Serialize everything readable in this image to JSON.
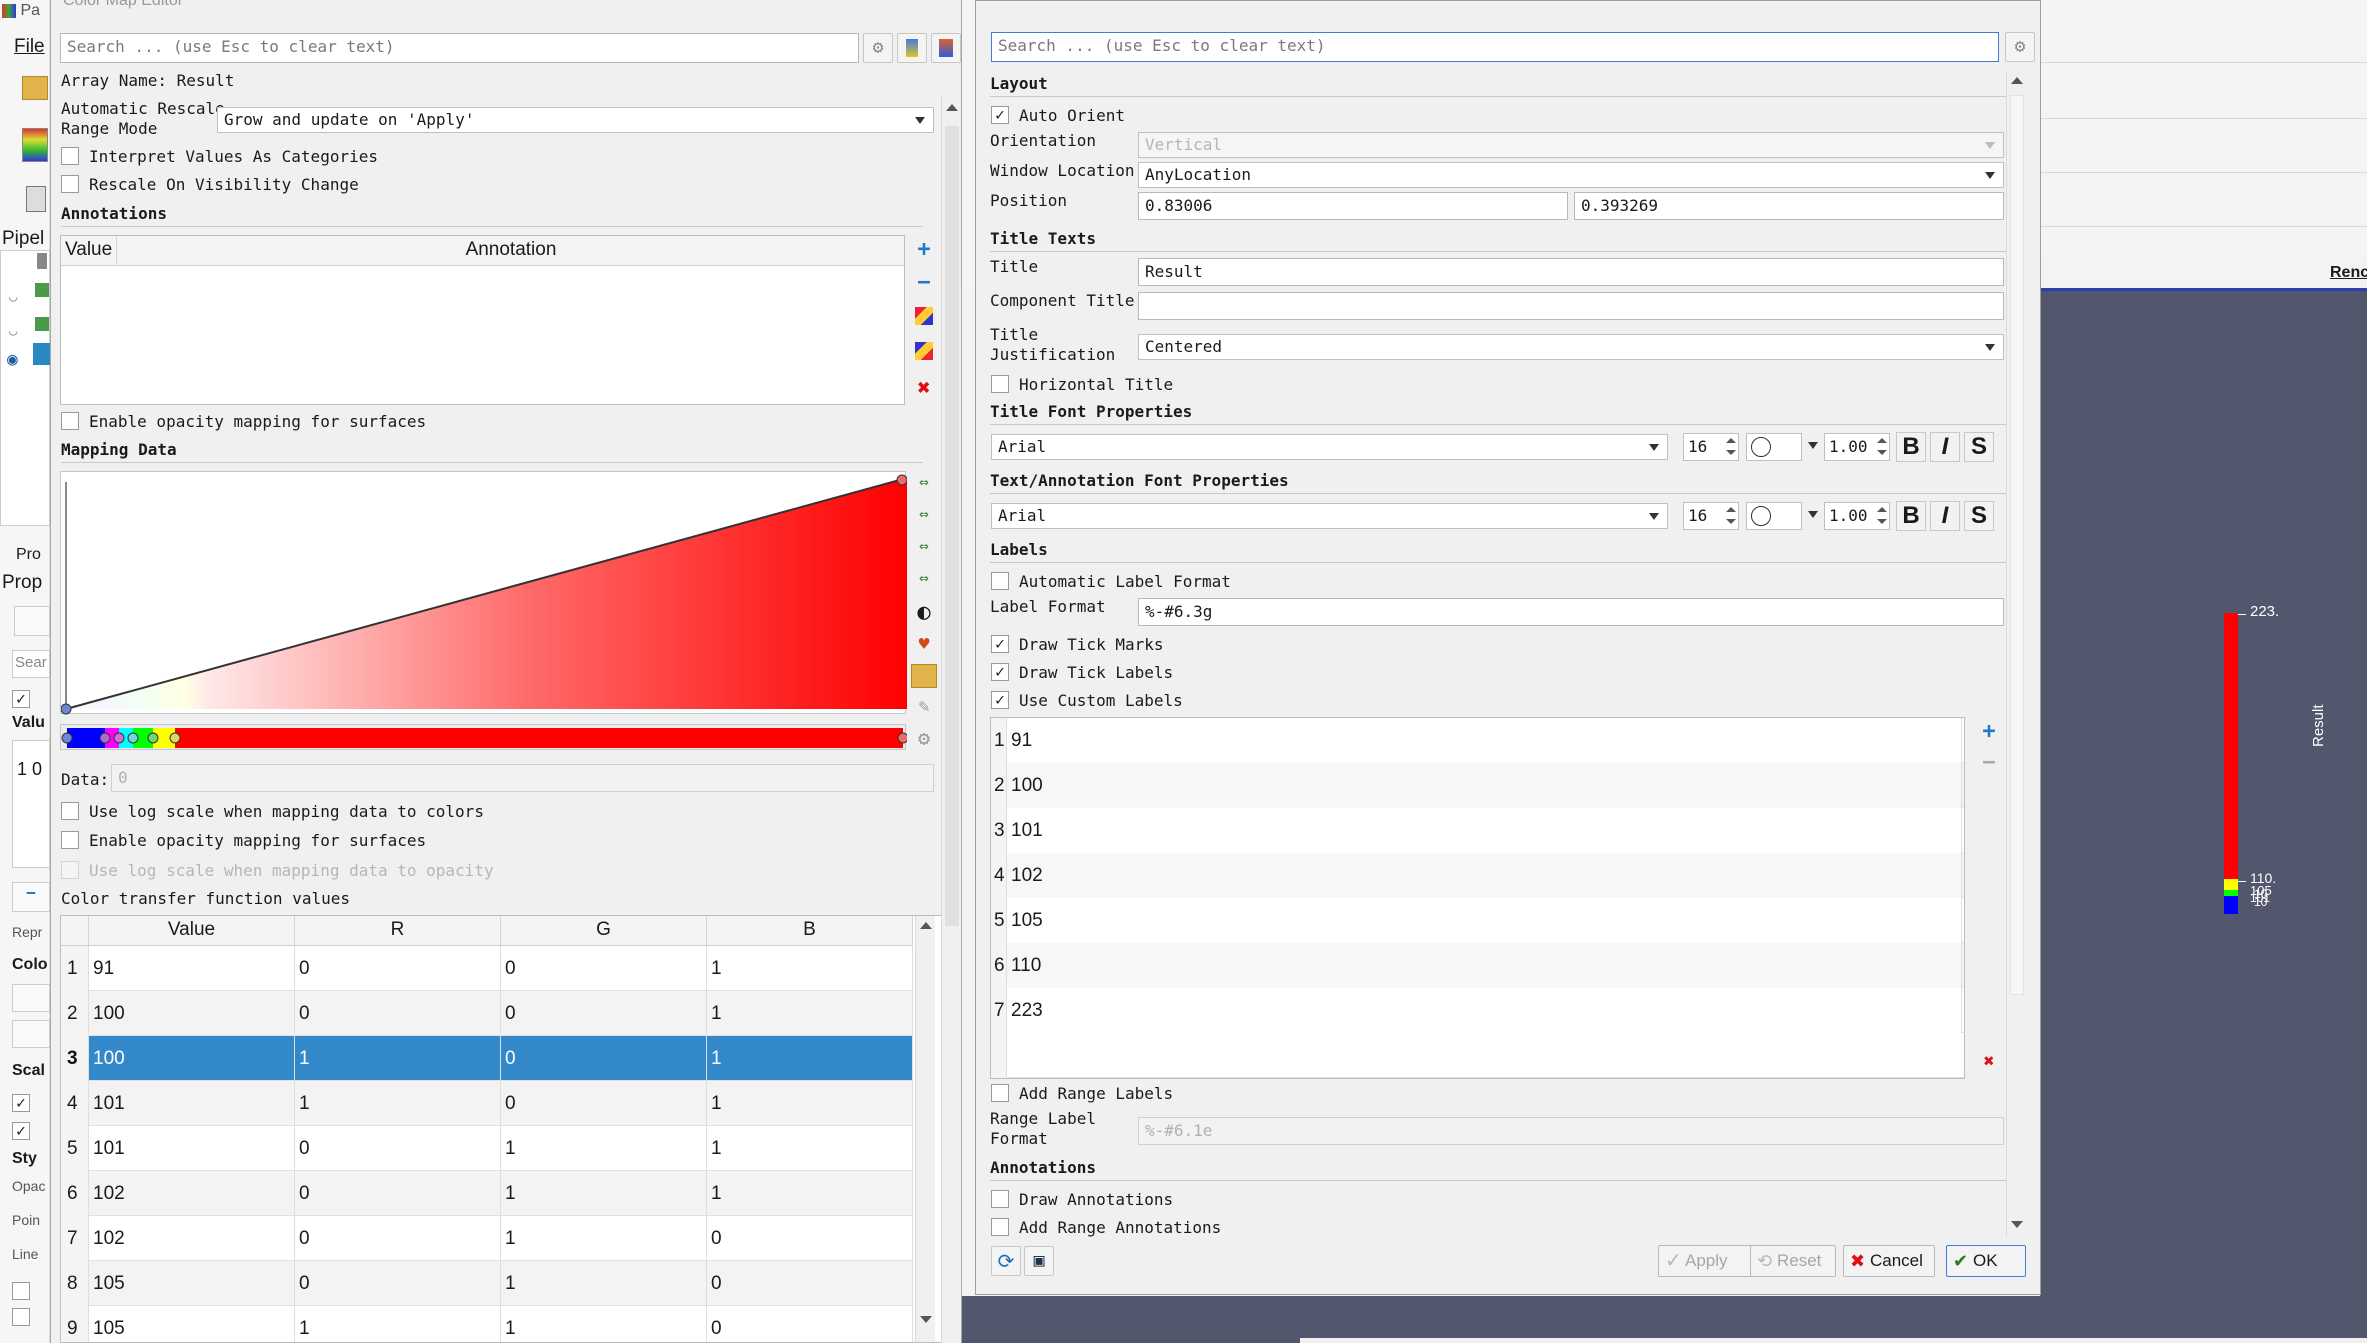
{
  "main": {
    "title_fragment": "Pa",
    "menu_file": "File",
    "pipeline_label": "Pipel",
    "properties_tab": "Pro",
    "properties_label": "Prop",
    "search_stub": "Sear",
    "value_stub": "Valu",
    "row_stub": "1 0",
    "repr_stub": "Repr",
    "color_stub": "Colo",
    "scale_stub": "Scal",
    "style_stub": "Sty",
    "opac_stub": "Opac",
    "point_stub": "Poin",
    "line_stub": "Line",
    "render_tab": "Renc",
    "legend": {
      "title": "Result",
      "labels": [
        "223.",
        "110.",
        "105",
        "10",
        "101",
        "10"
      ],
      "colors": [
        "#ff0000",
        "#ffff00",
        "#00ff00",
        "#0000ff"
      ]
    }
  },
  "color_map_editor": {
    "title": "Color Map Editor",
    "search_placeholder": "Search ... (use Esc to clear text)",
    "array_name": "Array Name: Result",
    "rescale_label_1": "Automatic Rescale",
    "rescale_label_2": "Range Mode",
    "rescale_value": "Grow and update on 'Apply'",
    "interpret_categories": "Interpret Values As Categories",
    "rescale_visibility": "Rescale On Visibility Change",
    "annotations_header": "Annotations",
    "annotations_columns": [
      "Value",
      "Annotation"
    ],
    "enable_opacity_surfaces_1": "Enable opacity mapping for surfaces",
    "mapping_data_header": "Mapping Data",
    "data_label": "Data:",
    "data_value": "0",
    "log_scale_colors": "Use log scale when mapping data to colors",
    "enable_opacity_surfaces_2": "Enable opacity mapping for surfaces",
    "log_scale_opacity": "Use log scale when mapping data to opacity",
    "ctf_header": "Color transfer function values",
    "ctf_columns": [
      "Value",
      "R",
      "G",
      "B"
    ],
    "ctf_rows": [
      {
        "n": "1",
        "v": "91",
        "r": "0",
        "g": "0",
        "b": "1"
      },
      {
        "n": "2",
        "v": "100",
        "r": "0",
        "g": "0",
        "b": "1"
      },
      {
        "n": "3",
        "v": "100",
        "r": "1",
        "g": "0",
        "b": "1"
      },
      {
        "n": "4",
        "v": "101",
        "r": "1",
        "g": "0",
        "b": "1"
      },
      {
        "n": "5",
        "v": "101",
        "r": "0",
        "g": "1",
        "b": "1"
      },
      {
        "n": "6",
        "v": "102",
        "r": "0",
        "g": "1",
        "b": "1"
      },
      {
        "n": "7",
        "v": "102",
        "r": "0",
        "g": "1",
        "b": "0"
      },
      {
        "n": "8",
        "v": "105",
        "r": "0",
        "g": "1",
        "b": "0"
      },
      {
        "n": "9",
        "v": "105",
        "r": "1",
        "g": "1",
        "b": "0"
      }
    ],
    "selected_row": 3
  },
  "color_legend": {
    "search_placeholder": "Search ... (use Esc to clear text)",
    "layout_header": "Layout",
    "auto_orient": "Auto Orient",
    "orientation_label": "Orientation",
    "orientation_value": "Vertical",
    "window_location_label": "Window Location",
    "window_location_value": "AnyLocation",
    "position_label": "Position",
    "position_x": "0.83006",
    "position_y": "0.393269",
    "title_texts_header": "Title Texts",
    "title_label": "Title",
    "title_value": "Result",
    "component_title_label": "Component Title",
    "component_title_value": "",
    "title_justification_label_1": "Title",
    "title_justification_label_2": "Justification",
    "title_justification_value": "Centered",
    "horizontal_title": "Horizontal Title",
    "title_font_header": "Title Font Properties",
    "text_font_header": "Text/Annotation Font Properties",
    "font_family": "Arial",
    "font_size": "16",
    "font_opacity": "1.00",
    "bold_label": "B",
    "italic_label": "I",
    "shadow_label": "S",
    "labels_header": "Labels",
    "auto_label_format": "Automatic Label Format",
    "label_format_label": "Label Format",
    "label_format_value": "%-#6.3g",
    "draw_tick_marks": "Draw Tick Marks",
    "draw_tick_labels": "Draw Tick Labels",
    "use_custom_labels": "Use Custom Labels",
    "custom_labels": [
      {
        "n": "1",
        "v": "91"
      },
      {
        "n": "2",
        "v": "100"
      },
      {
        "n": "3",
        "v": "101"
      },
      {
        "n": "4",
        "v": "102"
      },
      {
        "n": "5",
        "v": "105"
      },
      {
        "n": "6",
        "v": "110"
      },
      {
        "n": "7",
        "v": "223"
      }
    ],
    "add_range_labels": "Add Range Labels",
    "range_label_format_label_1": "Range Label",
    "range_label_format_label_2": "Format",
    "range_label_format_value": "%-#6.1e",
    "annotations_header": "Annotations",
    "draw_annotations": "Draw Annotations",
    "add_range_annotations": "Add Range Annotations",
    "apply_button": "Apply",
    "reset_button": "Reset",
    "cancel_button": "Cancel",
    "ok_button": "OK"
  }
}
